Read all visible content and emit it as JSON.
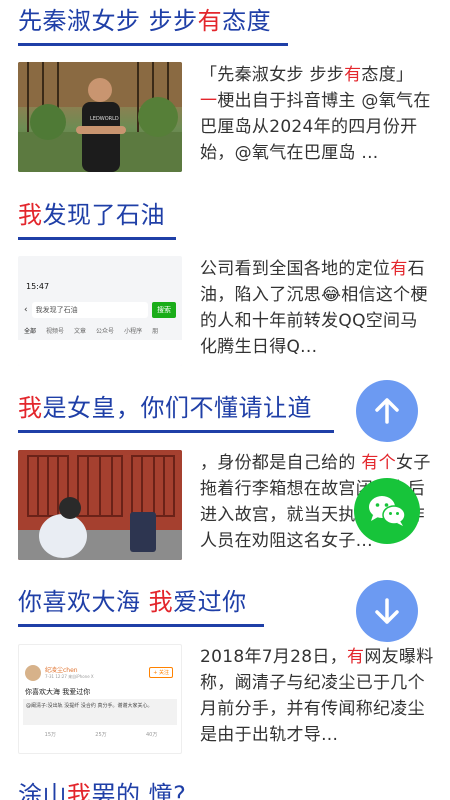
{
  "articles": [
    {
      "title_a": "先秦淑女步 步步",
      "title_hl": "有",
      "title_b": "态度",
      "summary_a": "「先秦淑女步 步步",
      "summary_hl": "有",
      "summary_b": "态度」",
      "summary_hl2": "一",
      "summary_c": "梗出自于抖音博主 @氧气在巴厘岛从2024年的四月份开始，@氧气在巴厘岛 ...",
      "thumb_caption": "LEDWORLD"
    },
    {
      "title_hl": "我",
      "title_b": "发现了石油",
      "summary_a": "公司看到全国各地的定位",
      "summary_hl": "有",
      "summary_b": "石油，陷入了沉思😂相信这个梗的人和十年前转发QQ空间马化腾生日得Q...",
      "phone": {
        "time": "15:47",
        "search_text": "我发现了石油",
        "search_btn": "搜索",
        "tabs": [
          "全部",
          "视频号",
          "文章",
          "公众号",
          "小程序",
          "朋"
        ]
      }
    },
    {
      "title_hl": "我",
      "title_b": "是女皇，你们不懂请让道",
      "summary_a": "，身份都是自己给的 ",
      "summary_hl": "有个",
      "summary_b": "女子拖着行李箱想在故宫闭关之后进入故宫，就当天执勤的工作人员在劝阻这名女子..."
    },
    {
      "title_a": "你喜欢大海 ",
      "title_hl": "我",
      "title_b": "爱过你",
      "summary_a": "2018年7月28日，",
      "summary_hl": "有",
      "summary_b": "网友曝料称，阚清子与纪凌尘已于几个月前分手，并有传闻称纪凌尘是由于出轨才导...",
      "weibo": {
        "user": "纪凌尘chen",
        "meta": "7-31 12:27  来自iPhone X",
        "follow": "+ 关注",
        "post": "你喜欢大海 我爱过你",
        "reply": "@阚清子:没出轨 没提纤 没合约 真分手。谢谢大家关心。",
        "stats": [
          "15万",
          "25万",
          "40万"
        ]
      }
    },
    {
      "title_a": "涂山",
      "title_hl": "我",
      "title_b": "罢的 憧?"
    }
  ],
  "colors": {
    "title_blue": "#1f3fa7",
    "highlight_red": "#e3262c",
    "fab_blue": "#6c9af2",
    "fab_green": "#17c43a"
  },
  "fabs": {
    "scroll_up": "arrow-up-icon",
    "wechat_share": "wechat-icon",
    "scroll_down": "arrow-down-icon"
  }
}
